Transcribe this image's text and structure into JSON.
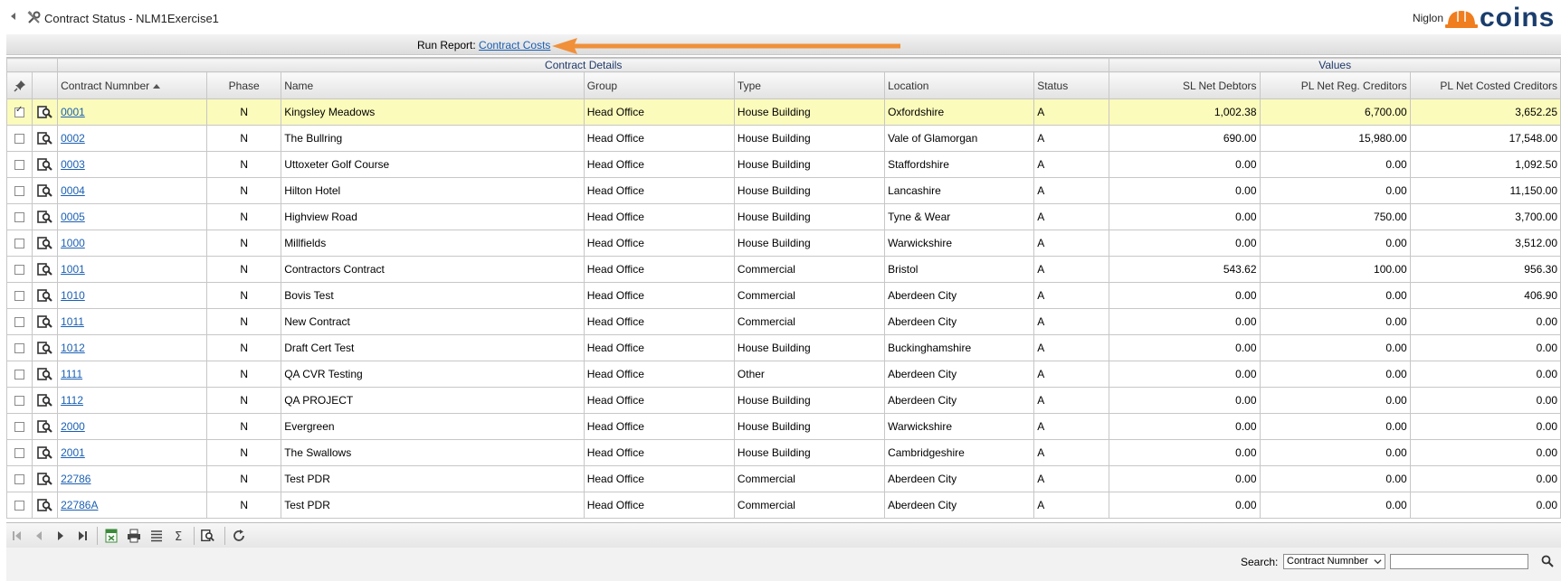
{
  "window": {
    "title": "Contract Status - NLM1Exercise1",
    "user": "Niglon",
    "logo_text": "coins"
  },
  "run_report": {
    "label": "Run Report:",
    "link": "Contract Costs"
  },
  "grid": {
    "group_headers": {
      "details": "Contract Details",
      "values": "Values"
    },
    "columns": {
      "contract": "Contract Numnber",
      "phase": "Phase",
      "name": "Name",
      "group": "Group",
      "type": "Type",
      "location": "Location",
      "status": "Status",
      "sl": "SL Net Debtors",
      "pl_reg": "PL Net Reg. Creditors",
      "pl_cost": "PL Net Costed Creditors"
    },
    "rows": [
      {
        "checked": true,
        "contract": "0001",
        "phase": "N",
        "name": "Kingsley Meadows",
        "group": "Head Office",
        "type": "House Building",
        "location": "Oxfordshire",
        "status": "A",
        "sl": "1,002.38",
        "pl_reg": "6,700.00",
        "pl_cost": "3,652.25"
      },
      {
        "checked": false,
        "contract": "0002",
        "phase": "N",
        "name": "The Bullring",
        "group": "Head Office",
        "type": "House Building",
        "location": "Vale of Glamorgan",
        "status": "A",
        "sl": "690.00",
        "pl_reg": "15,980.00",
        "pl_cost": "17,548.00"
      },
      {
        "checked": false,
        "contract": "0003",
        "phase": "N",
        "name": "Uttoxeter Golf Course",
        "group": "Head Office",
        "type": "House Building",
        "location": "Staffordshire",
        "status": "A",
        "sl": "0.00",
        "pl_reg": "0.00",
        "pl_cost": "1,092.50"
      },
      {
        "checked": false,
        "contract": "0004",
        "phase": "N",
        "name": "Hilton Hotel",
        "group": "Head Office",
        "type": "House Building",
        "location": "Lancashire",
        "status": "A",
        "sl": "0.00",
        "pl_reg": "0.00",
        "pl_cost": "11,150.00"
      },
      {
        "checked": false,
        "contract": "0005",
        "phase": "N",
        "name": "Highview Road",
        "group": "Head Office",
        "type": "House Building",
        "location": "Tyne & Wear",
        "status": "A",
        "sl": "0.00",
        "pl_reg": "750.00",
        "pl_cost": "3,700.00"
      },
      {
        "checked": false,
        "contract": "1000",
        "phase": "N",
        "name": "Millfields",
        "group": "Head Office",
        "type": "House Building",
        "location": "Warwickshire",
        "status": "A",
        "sl": "0.00",
        "pl_reg": "0.00",
        "pl_cost": "3,512.00"
      },
      {
        "checked": false,
        "contract": "1001",
        "phase": "N",
        "name": "Contractors Contract",
        "group": "Head Office",
        "type": "Commercial",
        "location": "Bristol",
        "status": "A",
        "sl": "543.62",
        "pl_reg": "100.00",
        "pl_cost": "956.30"
      },
      {
        "checked": false,
        "contract": "1010",
        "phase": "N",
        "name": "Bovis Test",
        "group": "Head Office",
        "type": "Commercial",
        "location": "Aberdeen City",
        "status": "A",
        "sl": "0.00",
        "pl_reg": "0.00",
        "pl_cost": "406.90"
      },
      {
        "checked": false,
        "contract": "1011",
        "phase": "N",
        "name": "New Contract",
        "group": "Head Office",
        "type": "Commercial",
        "location": "Aberdeen City",
        "status": "A",
        "sl": "0.00",
        "pl_reg": "0.00",
        "pl_cost": "0.00"
      },
      {
        "checked": false,
        "contract": "1012",
        "phase": "N",
        "name": "Draft Cert Test",
        "group": "Head Office",
        "type": "House Building",
        "location": "Buckinghamshire",
        "status": "A",
        "sl": "0.00",
        "pl_reg": "0.00",
        "pl_cost": "0.00"
      },
      {
        "checked": false,
        "contract": "1111",
        "phase": "N",
        "name": "QA CVR Testing",
        "group": "Head Office",
        "type": "Other",
        "location": "Aberdeen City",
        "status": "A",
        "sl": "0.00",
        "pl_reg": "0.00",
        "pl_cost": "0.00"
      },
      {
        "checked": false,
        "contract": "1112",
        "phase": "N",
        "name": "QA PROJECT",
        "group": "Head Office",
        "type": "House Building",
        "location": "Aberdeen City",
        "status": "A",
        "sl": "0.00",
        "pl_reg": "0.00",
        "pl_cost": "0.00"
      },
      {
        "checked": false,
        "contract": "2000",
        "phase": "N",
        "name": "Evergreen",
        "group": "Head Office",
        "type": "House Building",
        "location": "Warwickshire",
        "status": "A",
        "sl": "0.00",
        "pl_reg": "0.00",
        "pl_cost": "0.00"
      },
      {
        "checked": false,
        "contract": "2001",
        "phase": "N",
        "name": "The Swallows",
        "group": "Head Office",
        "type": "House Building",
        "location": "Cambridgeshire",
        "status": "A",
        "sl": "0.00",
        "pl_reg": "0.00",
        "pl_cost": "0.00"
      },
      {
        "checked": false,
        "contract": "22786",
        "phase": "N",
        "name": "Test PDR",
        "group": "Head Office",
        "type": "Commercial",
        "location": "Aberdeen City",
        "status": "A",
        "sl": "0.00",
        "pl_reg": "0.00",
        "pl_cost": "0.00"
      },
      {
        "checked": false,
        "contract": "22786A",
        "phase": "N",
        "name": "Test PDR",
        "group": "Head Office",
        "type": "Commercial",
        "location": "Aberdeen City",
        "status": "A",
        "sl": "0.00",
        "pl_reg": "0.00",
        "pl_cost": "0.00"
      }
    ]
  },
  "search": {
    "label": "Search:",
    "selected": "Contract Numnber",
    "value": ""
  },
  "colors": {
    "link": "#1a5fb4",
    "selected_row": "#fbfbbb",
    "arrow": "#f0903a",
    "logo_orange": "#f07d1e",
    "logo_blue": "#1a3d6d"
  }
}
